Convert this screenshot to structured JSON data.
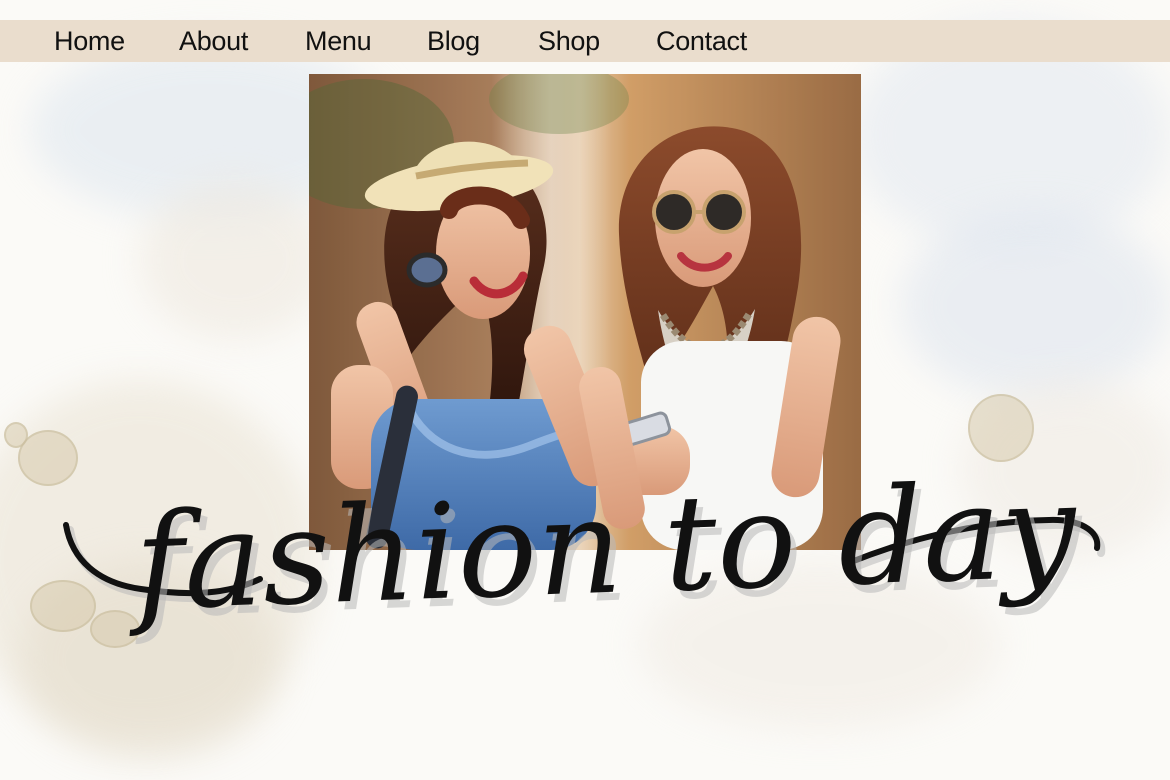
{
  "nav": {
    "items": [
      {
        "label": "Home"
      },
      {
        "label": "About"
      },
      {
        "label": "Menu"
      },
      {
        "label": "Blog"
      },
      {
        "label": "Shop"
      },
      {
        "label": "Contact"
      }
    ]
  },
  "hero": {
    "title": "fashion to day"
  },
  "colors": {
    "nav_bar": "#eaddcd",
    "nav_text": "#111111",
    "title_ink": "#111111"
  },
  "icons": {
    "hero_image": "fashion-photo-image"
  }
}
